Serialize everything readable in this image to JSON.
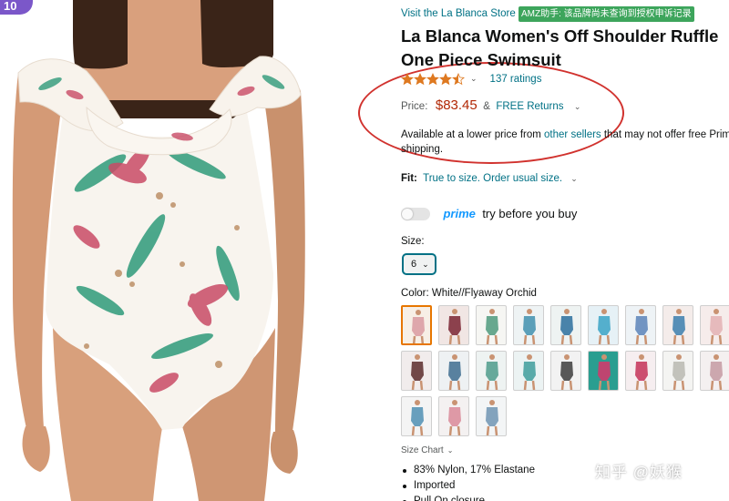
{
  "image": {
    "badge": "10"
  },
  "store": {
    "link": "Visit the La Blanca Store"
  },
  "extension_chip": "AMZ助手: 该品牌尚未查询到授权申诉记录",
  "product": {
    "title": "La Blanca Women's Off Shoulder Ruffle One Piece Swimsuit",
    "rating": 4.5,
    "rating_count": "137 ratings"
  },
  "price": {
    "label": "Price:",
    "value": "$83.45",
    "amp": "&",
    "returns": "FREE Returns"
  },
  "lower_price": {
    "prefix": "Available at a lower price from ",
    "link": "other sellers",
    "suffix": " that may not offer free Prime shipping."
  },
  "fit": {
    "label": "Fit:",
    "value": "True to size. Order usual size."
  },
  "prime": {
    "logo": "prime",
    "text": "try before you buy",
    "enabled": false
  },
  "size": {
    "label": "Size:",
    "selected": "6"
  },
  "color": {
    "label": "Color:",
    "value": "White//Flyaway Orchid"
  },
  "swatches": [
    {
      "selected": true,
      "bg": "#f7efe6",
      "accent": "#d99aa0"
    },
    {
      "selected": false,
      "bg": "#f1e6e4",
      "accent": "#7a2333"
    },
    {
      "selected": false,
      "bg": "#f6f6f3",
      "accent": "#4f9a7c"
    },
    {
      "selected": false,
      "bg": "#eef3f4",
      "accent": "#3f8fae"
    },
    {
      "selected": false,
      "bg": "#eef3f2",
      "accent": "#2c6f9e"
    },
    {
      "selected": false,
      "bg": "#e6f1f6",
      "accent": "#3aa3c6"
    },
    {
      "selected": false,
      "bg": "#eef3f6",
      "accent": "#5a82b8"
    },
    {
      "selected": false,
      "bg": "#f4ecea",
      "accent": "#3b7fae"
    },
    {
      "selected": false,
      "bg": "#f6eceb",
      "accent": "#e3b1b4"
    },
    {
      "selected": false,
      "bg": "#f1ecec",
      "accent": "#5a2c2c"
    },
    {
      "selected": false,
      "bg": "#eef1f3",
      "accent": "#3e6d8f"
    },
    {
      "selected": false,
      "bg": "#eef3f2",
      "accent": "#4d9b8c"
    },
    {
      "selected": false,
      "bg": "#ecf3f3",
      "accent": "#3f9c9b"
    },
    {
      "selected": false,
      "bg": "#f2f2f2",
      "accent": "#3d3d3d"
    },
    {
      "selected": false,
      "bg": "#2a9e90",
      "accent": "#d8356b"
    },
    {
      "selected": false,
      "bg": "#f6eef0",
      "accent": "#c43158"
    },
    {
      "selected": false,
      "bg": "#f4f4f2",
      "accent": "#b9b9b1"
    },
    {
      "selected": false,
      "bg": "#f4f0f0",
      "accent": "#c49aa2"
    },
    {
      "selected": false,
      "bg": "#f4f4f4",
      "accent": "#4f8fb3"
    },
    {
      "selected": false,
      "bg": "#f4f1f1",
      "accent": "#d98a99"
    },
    {
      "selected": false,
      "bg": "#f3f5f6",
      "accent": "#6e94b3"
    }
  ],
  "size_chart": "Size Chart",
  "bullets": [
    "83% Nylon, 17% Elastane",
    "Imported",
    "Pull On closure"
  ],
  "watermark": "知乎 @妖猴",
  "colors": {
    "link": "#007185",
    "price": "#b12704",
    "annotation_oval": "#d1322e",
    "badge": "#7b57c9",
    "chip": "#3da55c",
    "prime_blue": "#1399ff",
    "selected_swatch": "#e77600"
  }
}
